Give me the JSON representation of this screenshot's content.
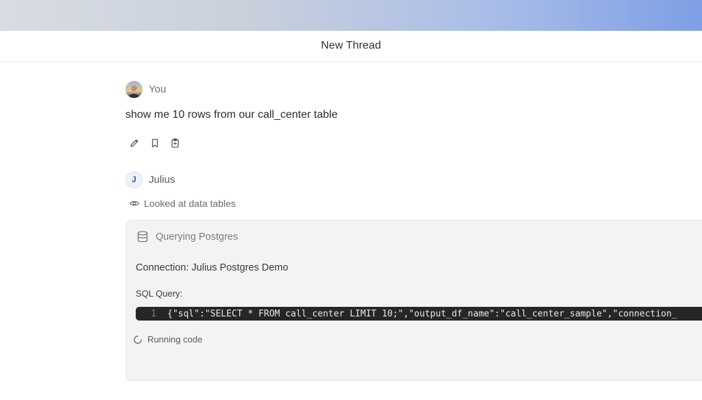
{
  "header": {
    "title": "New Thread"
  },
  "user_message": {
    "author": "You",
    "text": "show me 10 rows from our call_center table",
    "actions": [
      {
        "icon": "pencil-icon"
      },
      {
        "icon": "bookmark-icon"
      },
      {
        "icon": "copy-icon"
      }
    ]
  },
  "assistant_message": {
    "avatar_letter": "J",
    "author": "Julius",
    "status_step": {
      "icon": "eye-icon",
      "text": "Looked at data tables"
    },
    "tool_card": {
      "icon": "database-icon",
      "title": "Querying Postgres",
      "connection": "Connection: Julius Postgres Demo",
      "sql_label": "SQL Query:",
      "code_line_number": "1",
      "code": "{\"sql\":\"SELECT * FROM call_center LIMIT 10;\",\"output_df_name\":\"call_center_sample\",\"connection_",
      "running_text": "Running code"
    }
  },
  "colors": {
    "banner_left": "#d8dce3",
    "banner_right": "#7e9fe6",
    "card_bg": "#f3f3f4",
    "code_bg": "#262626",
    "avatar_letter": "#3a5ba8"
  }
}
